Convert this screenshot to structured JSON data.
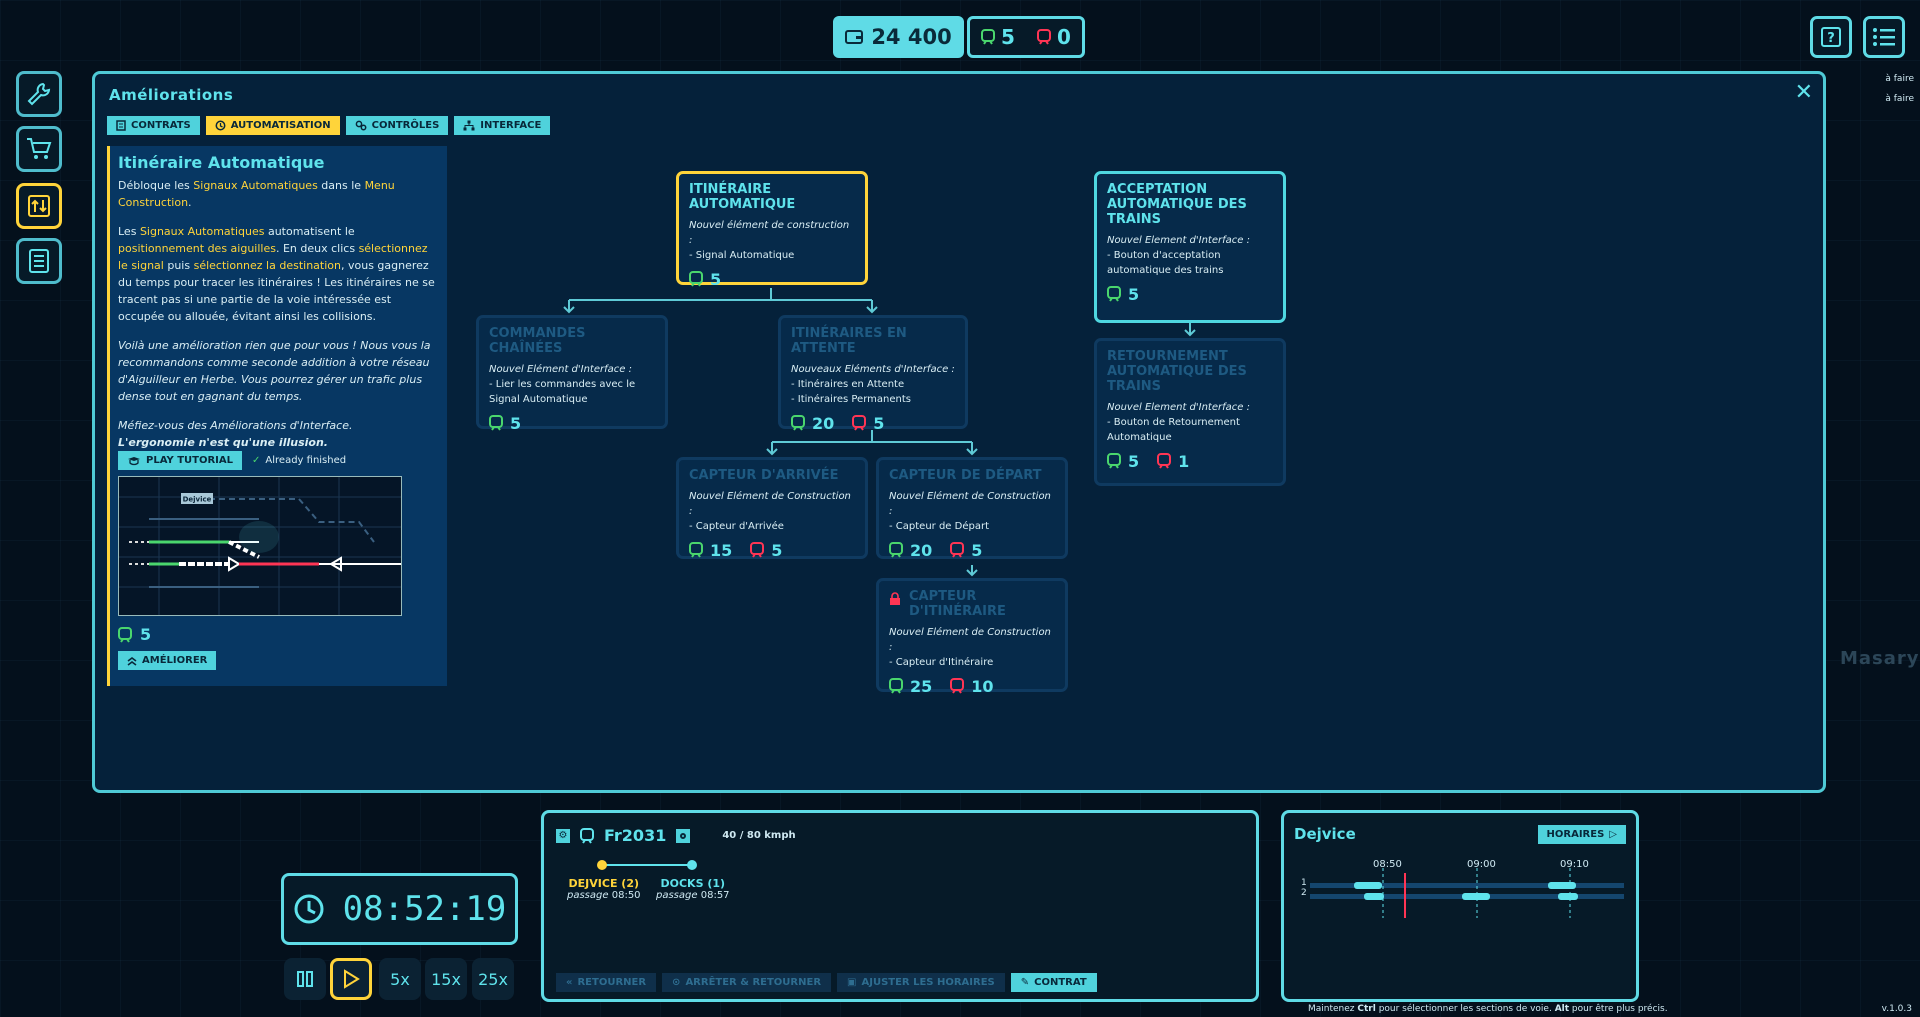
{
  "hud": {
    "money": "24 400",
    "trains_green": "5",
    "trains_red": "0"
  },
  "panel": {
    "title": "Améliorations",
    "close": "✕",
    "tabs": [
      {
        "label": "CONTRATS"
      },
      {
        "label": "AUTOMATISATION"
      },
      {
        "label": "CONTRÔLES"
      },
      {
        "label": "INTERFACE"
      }
    ]
  },
  "info": {
    "title": "Itinéraire Automatique",
    "p1a": "Débloque les ",
    "p1b": "Signaux Automatiques",
    "p1c": " dans le ",
    "p1d": "Menu Construction",
    "p1e": ".",
    "p2a": "Les ",
    "p2b": "Signaux Automatiques",
    "p2c": " automatisent le ",
    "p2d": "positionnement des aiguilles",
    "p2e": ". En deux clics ",
    "p2f": "sélectionnez le signal",
    "p2g": " puis ",
    "p2h": "sélectionnez la destination",
    "p2i": ", vous gagnerez du temps pour tracer les itinéraires ! Les itinéraires ne se tracent pas si une partie de la voie intéressée est occupée ou allouée, évitant ainsi les collisions.",
    "p3": "Voilà une amélioration rien que pour vous ! Nous vous la recommandons comme seconde addition à votre réseau d'Aiguilleur en Herbe. Vous pourrez gérer un trafic plus dense tout en gagnant du temps.",
    "p4a": "Méfiez-vous des Améliorations d'Interface.",
    "p4b": "L'ergonomie n'est qu'une illusion.",
    "tutorial_label": "PLAY TUTORIAL",
    "finished_label": "Already finished",
    "preview_station": "Dejvice",
    "cost": "5",
    "upgrade_label": "AMÉLIORER"
  },
  "nodes": {
    "itin_auto": {
      "title": "Itinéraire Automatique",
      "sub": "Nouvel élément de construction :",
      "item": "- Signal Automatique",
      "green": "5"
    },
    "commandes": {
      "title": "Commandes chaînées",
      "sub": "Nouvel Elément d'Interface :",
      "item": "- Lier les commandes avec le Signal Automatique",
      "green": "5"
    },
    "attente": {
      "title": "Itinéraires en attente",
      "sub": "Nouveaux Eléments d'Interface :",
      "item1": "- Itinéraires en Attente",
      "item2": "- Itinéraires Permanents",
      "green": "20",
      "red": "5"
    },
    "arrivee": {
      "title": "Capteur d'arrivée",
      "sub": "Nouvel Elément de Construction :",
      "item": "- Capteur d'Arrivée",
      "green": "15",
      "red": "5"
    },
    "depart": {
      "title": "Capteur de départ",
      "sub": "Nouvel Elément de Construction :",
      "item": "- Capteur de Départ",
      "green": "20",
      "red": "5"
    },
    "capteur_itin": {
      "title": "Capteur d'itinéraire",
      "sub": "Nouvel Elément de Construction :",
      "item": "- Capteur d'Itinéraire",
      "green": "25",
      "red": "10"
    },
    "acceptation": {
      "title": "Acceptation automatique des trains",
      "sub": "Nouvel Element d'Interface :",
      "item": "- Bouton d'acceptation automatique des trains",
      "green": "5"
    },
    "retournement": {
      "title": "Retournement automatique des trains",
      "sub": "Nouvel Element d'Interface :",
      "item": "- Bouton de Retournement Automatique",
      "green": "5",
      "red": "1"
    }
  },
  "clock": {
    "time": "08:52:19",
    "speeds": [
      "5x",
      "15x",
      "25x"
    ]
  },
  "train": {
    "id": "Fr2031",
    "speed": "40 / 80 kmph",
    "stops": [
      {
        "name": "DEJVICE (2)",
        "label": "passage",
        "time": "08:50"
      },
      {
        "name": "DOCKS (1)",
        "label": "passage",
        "time": "08:57"
      }
    ],
    "actions": [
      "RETOURNER",
      "ARRÊTER & RETOURNER",
      "AJUSTER LES HORAIRES",
      "CONTRAT"
    ]
  },
  "station": {
    "name": "Dejvice",
    "schedule_label": "HORAIRES",
    "times": [
      "08:50",
      "09:00",
      "09:10"
    ],
    "tracks": [
      "1",
      "2"
    ]
  },
  "footer": {
    "hint_a": "Maintenez ",
    "hint_ctrl": "Ctrl",
    "hint_b": " pour sélectionner les sections de voie. ",
    "hint_alt": "Alt",
    "hint_c": " pour être plus précis.",
    "version": "v.1.0.3"
  },
  "side": {
    "todo1": "à faire",
    "todo2": "à faire",
    "station_bg": "Masaryk"
  }
}
